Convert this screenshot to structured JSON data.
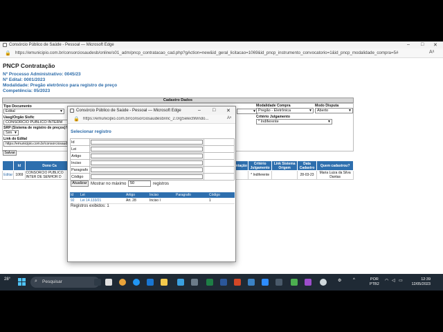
{
  "browser": {
    "title": "Consórcio Público de Saúde - Pessoal — Microsoft Edge",
    "url": "https://emunicipio.com.br/consorciosaudesb/online/s01_adm/pncp_contratacao_cad.php?gAction=new&id_geral_licitacao=1069&id_pncp_instrumento_convocatorio=1&id_pncp_modalidade_compra=5#"
  },
  "page": {
    "title": "PNCP Contratação",
    "processo": "Nº Processo Administrativo: 0045/23",
    "edital": "Nº Edital: 0001/2023",
    "modalidade": "Modalidade: Pregão eletrônico para registro de preço",
    "competencia": "Competência: 05/2023",
    "cadastro_header": "Cadastro Dados"
  },
  "form": {
    "tipo_documento_label": "Tipo Documento",
    "tipo_documento_value": "Edital",
    "uasg_label": "Uasg/Orgão Sisfic",
    "uasg_value": "CONSORCIO PUBLICO INTERM",
    "srp_label": "SRP (Sistema de registro de preços)?",
    "srp_value": "Sim",
    "link_label": "Link do Edital",
    "link_value": "https://emunicipio.com.br/consorciosaude",
    "modalidade_label": "Modalidade Compra",
    "modalidade_value": "Pregão - Eletrônica",
    "modo_label": "Modo Disputa",
    "modo_value": "Aberto",
    "criterio_label": "Critério Julgamento",
    "criterio_value": "* Indiferente",
    "save_label": "Salvar"
  },
  "grid": {
    "headers": [
      "",
      "Id",
      "Dono Ca",
      "entação",
      "Critério Julgamento",
      "Link Sistema Origem",
      "Data Cadastro",
      "Quem cadastrou?"
    ],
    "row": [
      "Editar",
      "1069",
      "CONSORCIO PUBLICO INTER DE SENHOR D",
      "",
      "* Indiferente",
      "",
      "28-03-23",
      "Maria Luiza da Silva Dantas"
    ]
  },
  "popup": {
    "title": "Consórcio Público de Saúde - Pessoal — Microsoft Edge",
    "url": "https://emunicipio.com.br/consorciosaudesb/inc_2.0/gSelectWindo...",
    "heading": "Selecionar registro",
    "filters": [
      "Id",
      "Lei",
      "Artigo",
      "Inciso",
      "Paragrafo",
      "Código"
    ],
    "atualizar_label": "Atualizar",
    "mostrar_label": "Mostrar no máximo",
    "mostrar_value": "50",
    "registros_label": "registros",
    "result_headers": [
      "Id",
      "Lei",
      "Artigo",
      "Inciso",
      "Paragrafo",
      "Código"
    ],
    "result_row": [
      "92",
      "Lei 14.133/21",
      "Art. 28",
      "Inciso I",
      "",
      "1"
    ],
    "count_label": "Registros exibidos: 1"
  },
  "taskbar": {
    "weather": "28°",
    "search_label": "Pesquisar",
    "lang_line1": "POR",
    "lang_line2": "PTB2",
    "time": "12:39",
    "date": "12/05/2023"
  }
}
